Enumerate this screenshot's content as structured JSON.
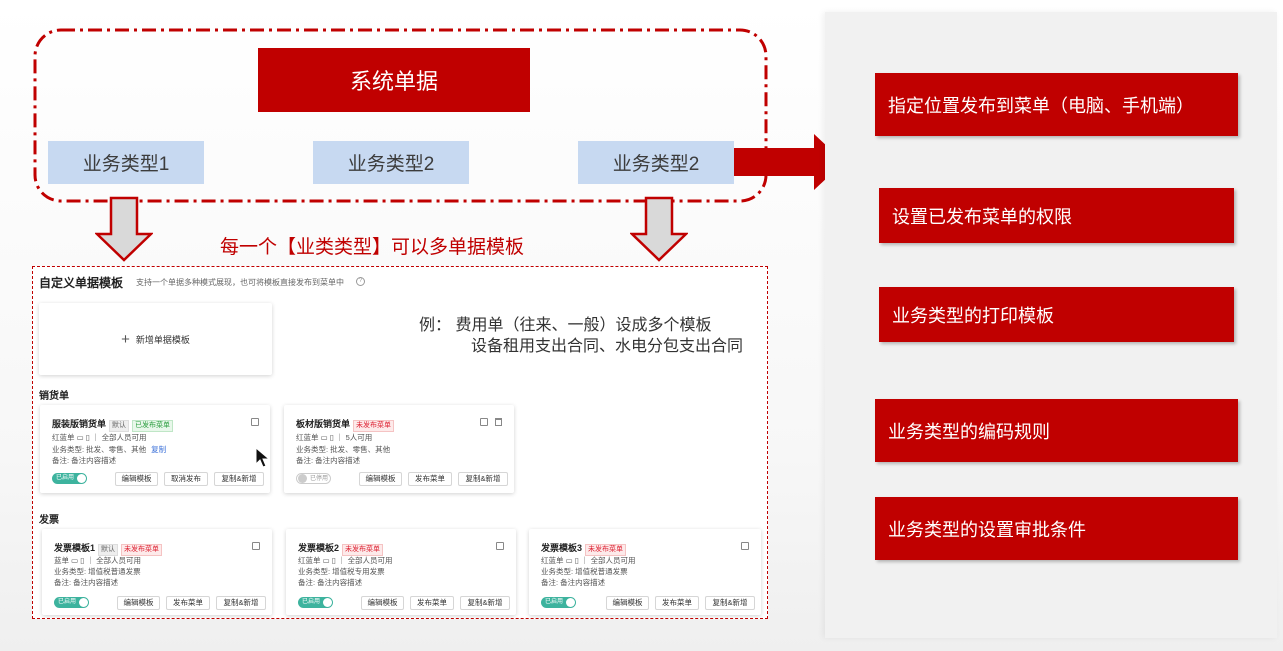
{
  "top": {
    "system_label": "系统单据",
    "business_types": [
      "业务类型1",
      "业务类型2",
      "业务类型2"
    ]
  },
  "note": "每一个【业类类型】可以多单据模板",
  "panel": {
    "title": "自定义单据模板",
    "subtitle": "支持一个单据多种模式展现，也可将模板直接发布到菜单中",
    "help_icon": "?",
    "new_template": "新增单据模板",
    "example_line1": "例：  费用单（往来、一般）设成多个模板",
    "example_line2": "设备租用支出合同、水电分包支出合同",
    "sections": [
      {
        "title": "销货单",
        "cards": [
          {
            "name": "服装版销货单",
            "badges": [
              {
                "text": "默认",
                "kind": "def"
              },
              {
                "text": "已发布菜单",
                "kind": "pub"
              }
            ],
            "source": "红蓝单",
            "scope": "全部人员可用",
            "biz": "业务类型: 批发、零售、其他",
            "biz_link": "复制",
            "remark": "备注: 备注内容描述",
            "toggle": "已启用",
            "toggle_on": true,
            "buttons": [
              "编辑模板",
              "取消发布",
              "复制&新增"
            ]
          },
          {
            "name": "板材版销货单",
            "badges": [
              {
                "text": "未发布菜单",
                "kind": "unpub"
              }
            ],
            "source": "红蓝单",
            "scope": "5人可用",
            "biz": "业务类型: 批发、零售、其他",
            "biz_link": "",
            "remark": "备注: 备注内容描述",
            "toggle": "已停用",
            "toggle_on": false,
            "buttons": [
              "编辑模板",
              "发布菜单",
              "复制&新增"
            ]
          }
        ]
      },
      {
        "title": "发票",
        "cards": [
          {
            "name": "发票模板1",
            "badges": [
              {
                "text": "默认",
                "kind": "def"
              },
              {
                "text": "未发布菜单",
                "kind": "unpub"
              }
            ],
            "source": "蓝单",
            "scope": "全部人员可用",
            "biz": "业务类型: 增值税普通发票",
            "biz_link": "",
            "remark": "备注: 备注内容描述",
            "toggle": "已启用",
            "toggle_on": true,
            "buttons": [
              "编辑模板",
              "发布菜单",
              "复制&新增"
            ]
          },
          {
            "name": "发票模板2",
            "badges": [
              {
                "text": "未发布菜单",
                "kind": "unpub"
              }
            ],
            "source": "红蓝单",
            "scope": "全部人员可用",
            "biz": "业务类型: 增值税专用发票",
            "biz_link": "",
            "remark": "备注: 备注内容描述",
            "toggle": "已启用",
            "toggle_on": true,
            "buttons": [
              "编辑模板",
              "发布菜单",
              "复制&新增"
            ]
          },
          {
            "name": "发票模板3",
            "badges": [
              {
                "text": "未发布菜单",
                "kind": "unpub"
              }
            ],
            "source": "红蓝单",
            "scope": "全部人员可用",
            "biz": "业务类型: 增值税普通发票",
            "biz_link": "",
            "remark": "备注: 备注内容描述",
            "toggle": "已启用",
            "toggle_on": true,
            "buttons": [
              "编辑模板",
              "发布菜单",
              "复制&新增"
            ]
          }
        ]
      }
    ]
  },
  "features": [
    "指定位置发布到菜单（电脑、手机端）",
    "设置已发布菜单的权限",
    "业务类型的打印模板",
    "业务类型的编码规则",
    "业务类型的设置审批条件"
  ],
  "colors": {
    "accent_red": "#c00000",
    "light_blue": "#c7d9f1",
    "toggle_green": "#3db39e"
  }
}
